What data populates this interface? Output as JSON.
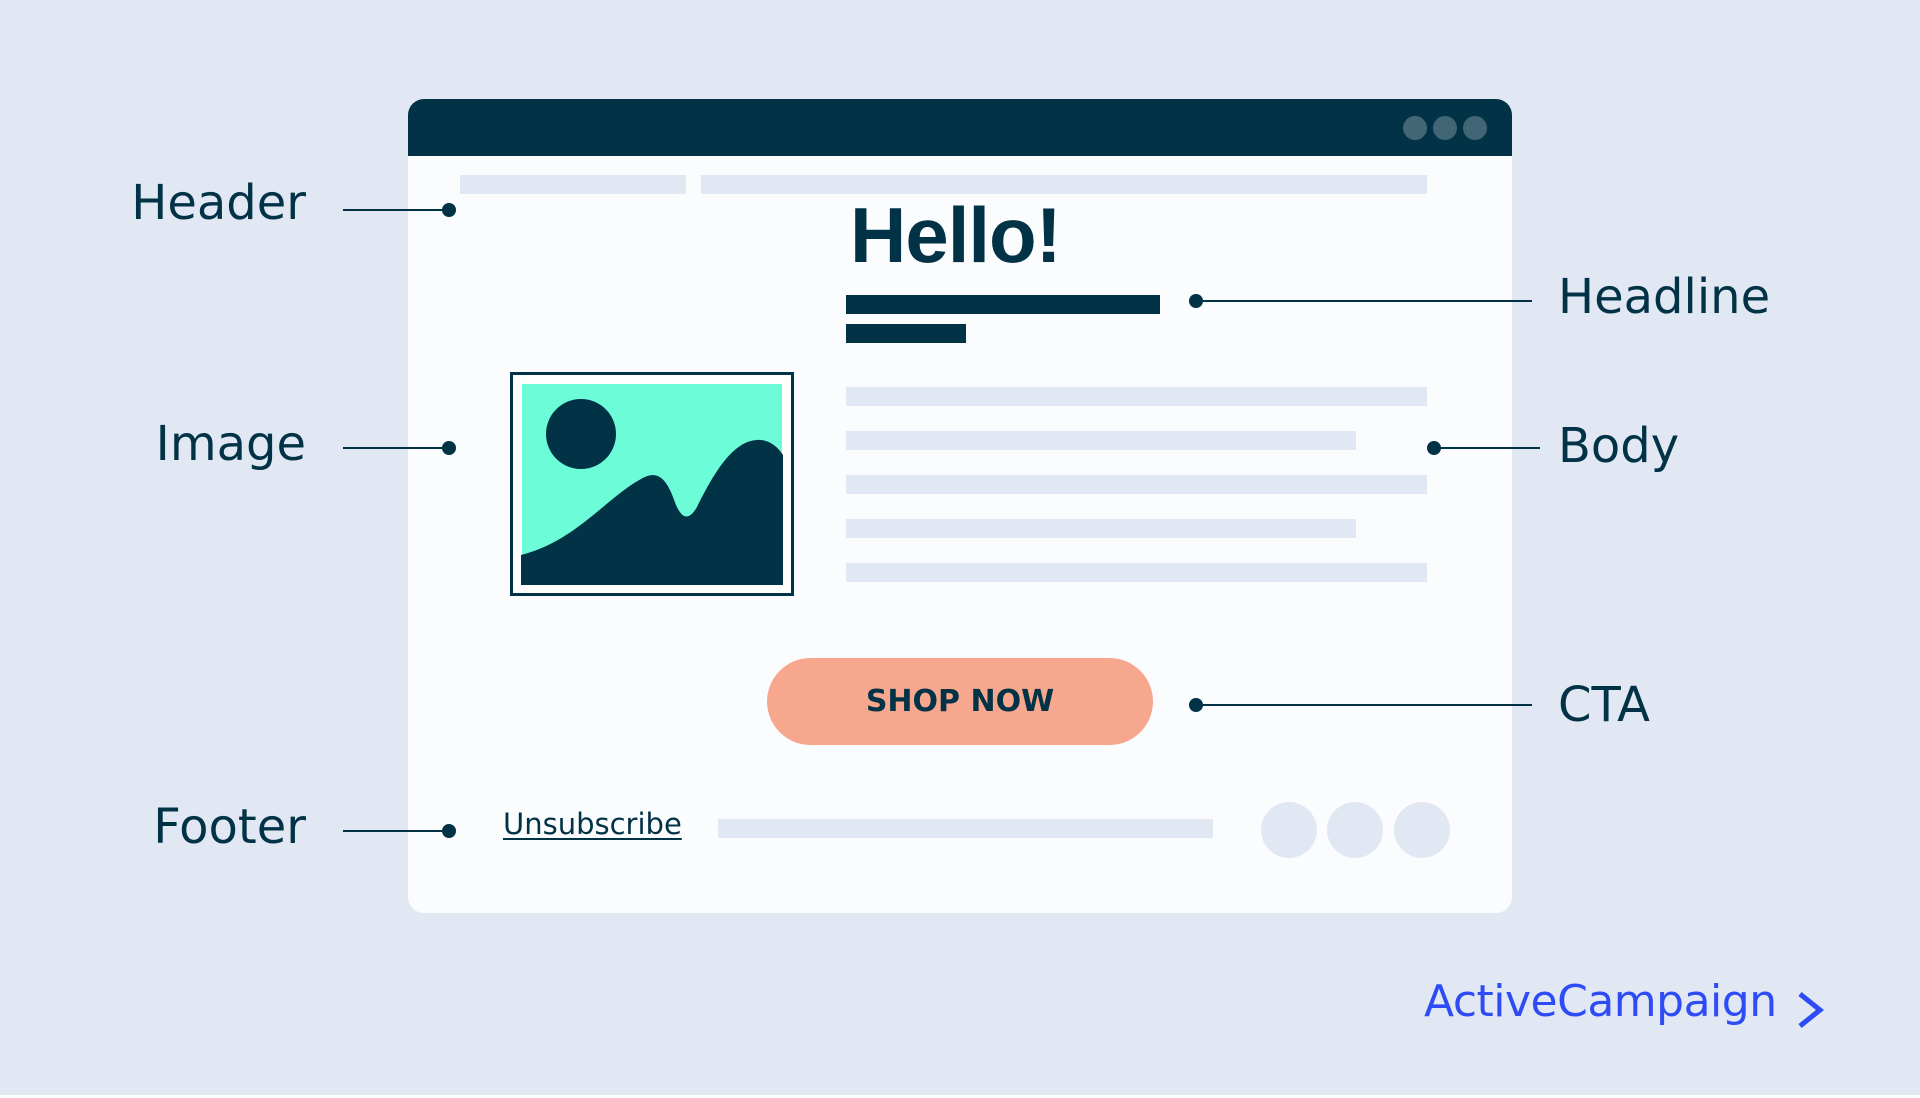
{
  "headline": {
    "text": "Hello!"
  },
  "cta": {
    "label": "SHOP NOW"
  },
  "footer": {
    "unsubscribe_label": "Unsubscribe"
  },
  "annotations": {
    "header": "Header",
    "image": "Image",
    "footer": "Footer",
    "headline": "Headline",
    "body": "Body",
    "cta": "CTA"
  },
  "brand": {
    "name": "ActiveCampaign",
    "icon": "chevron-right-icon"
  },
  "colors": {
    "background": "#e1e8f4",
    "navy": "#023246",
    "mint": "#6cfcd8",
    "cta": "#f8a78f",
    "brand_blue": "#2e4cf5",
    "window": "#fbfcfe"
  }
}
